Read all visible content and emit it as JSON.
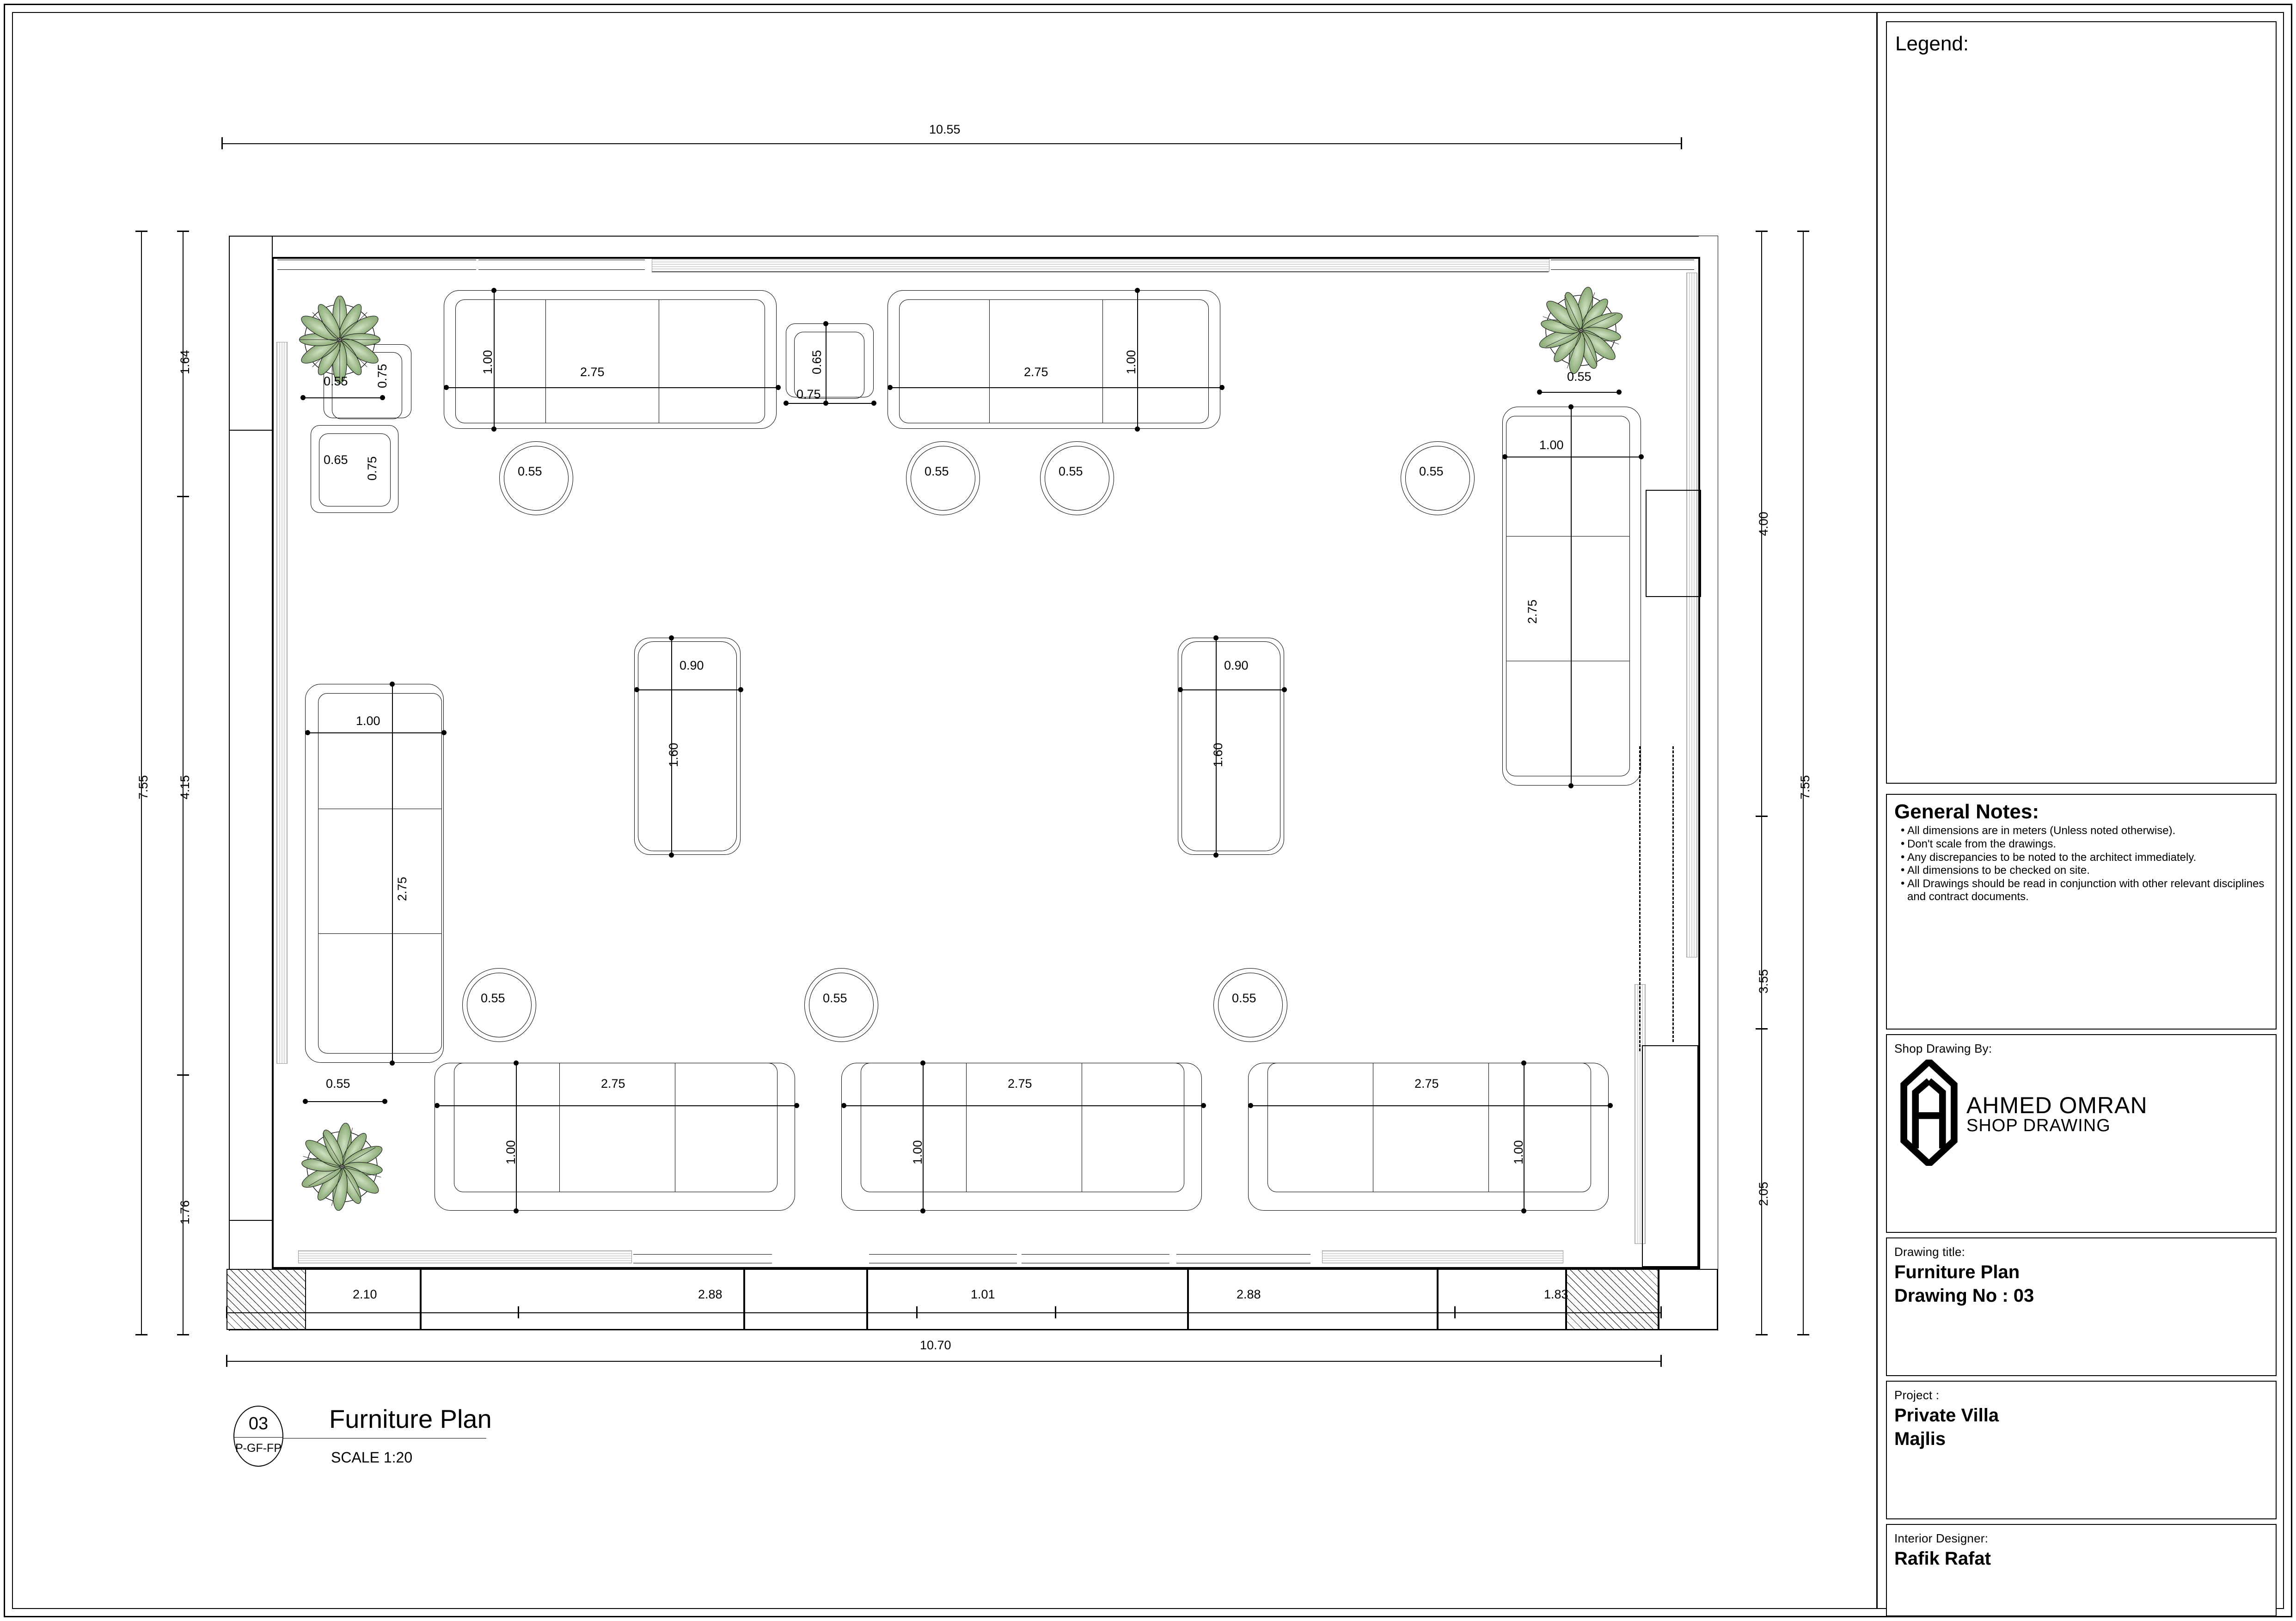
{
  "sheet": {
    "legend": {
      "title": "Legend:"
    },
    "general_notes": {
      "heading": "General Notes:",
      "items": [
        "All dimensions are in meters (Unless noted otherwise).",
        "Don't scale from the drawings.",
        "Any discrepancies to be noted to the architect immediately.",
        "All dimensions to be checked on site.",
        "All Drawings should be read in conjunction with other relevant disciplines and contract documents."
      ]
    },
    "shop_drawing_by": {
      "label": "Shop Drawing By:",
      "brand_line1": "AHMED OMRAN",
      "brand_line2": "SHOP DRAWING"
    },
    "drawing_title": {
      "label": "Drawing title:",
      "value_line1": "Furniture Plan",
      "value_line2": "Drawing No : 03"
    },
    "project": {
      "label": "Project :",
      "value_line1": "Private Villa",
      "value_line2": "Majlis"
    },
    "interior_designer": {
      "label": "Interior Designer:",
      "value": "Rafik Rafat"
    }
  },
  "plan_callout": {
    "number": "03",
    "code": "P-GF-FP",
    "title": "Furniture Plan",
    "scale": "SCALE 1:20"
  },
  "chart_data": {
    "type": "table",
    "title": "Furniture Plan - Majlis",
    "units": "meters",
    "scale": "1:20",
    "overall_dimensions": {
      "top_overall": "10.55",
      "bottom_overall": "10.70",
      "left_overall": "7.55",
      "right_overall": "7.55"
    },
    "dimension_strings": {
      "left_inner": [
        "1.64",
        "4.15",
        "1.76"
      ],
      "right_inner": [
        "4.00",
        "3.55",
        "2.05"
      ],
      "bottom_inner": [
        "2.10",
        "2.88",
        "1.01",
        "2.88",
        "1.83"
      ]
    },
    "furniture": [
      {
        "item": "sofa-3seat-top-left",
        "width": "2.75",
        "depth": "1.00"
      },
      {
        "item": "sofa-3seat-top-right",
        "width": "2.75",
        "depth": "1.00"
      },
      {
        "item": "sofa-3seat-right",
        "width": "1.00",
        "depth": "2.75"
      },
      {
        "item": "sofa-3seat-left",
        "width": "1.00",
        "depth": "2.75"
      },
      {
        "item": "sofa-3seat-bottom-1",
        "width": "2.75",
        "depth": "1.00"
      },
      {
        "item": "sofa-3seat-bottom-2",
        "width": "2.75",
        "depth": "1.00"
      },
      {
        "item": "sofa-3seat-bottom-3",
        "width": "2.75",
        "depth": "1.00"
      },
      {
        "item": "coffee-table-left",
        "width": "0.90",
        "depth": "1.60"
      },
      {
        "item": "coffee-table-right",
        "width": "0.90",
        "depth": "1.60"
      },
      {
        "item": "side-table-a",
        "width": "0.75",
        "depth": "0.65"
      },
      {
        "item": "side-table-b",
        "width": "0.75",
        "depth": "0.65"
      },
      {
        "item": "side-table-c",
        "width": "0.75",
        "depth": "0.65"
      },
      {
        "item": "stool-round",
        "count": 7,
        "diameter": "0.55"
      },
      {
        "item": "planter-round",
        "count": 3,
        "diameter": "0.55"
      }
    ]
  },
  "dims": {
    "top_overall": "10.55",
    "bottom_overall": "10.70",
    "left_overall": "7.55",
    "right_overall": "7.55",
    "l1": "1.64",
    "l2": "4.15",
    "l3": "1.76",
    "r1": "4.00",
    "r2": "3.55",
    "r3": "2.05",
    "b1": "2.10",
    "b2": "2.88",
    "b3": "1.01",
    "b4": "2.88",
    "b5": "1.83",
    "d055": "0.55",
    "d065": "0.65",
    "d075": "0.75",
    "d100": "1.00",
    "d275": "2.75",
    "d090": "0.90",
    "d160": "1.60"
  }
}
